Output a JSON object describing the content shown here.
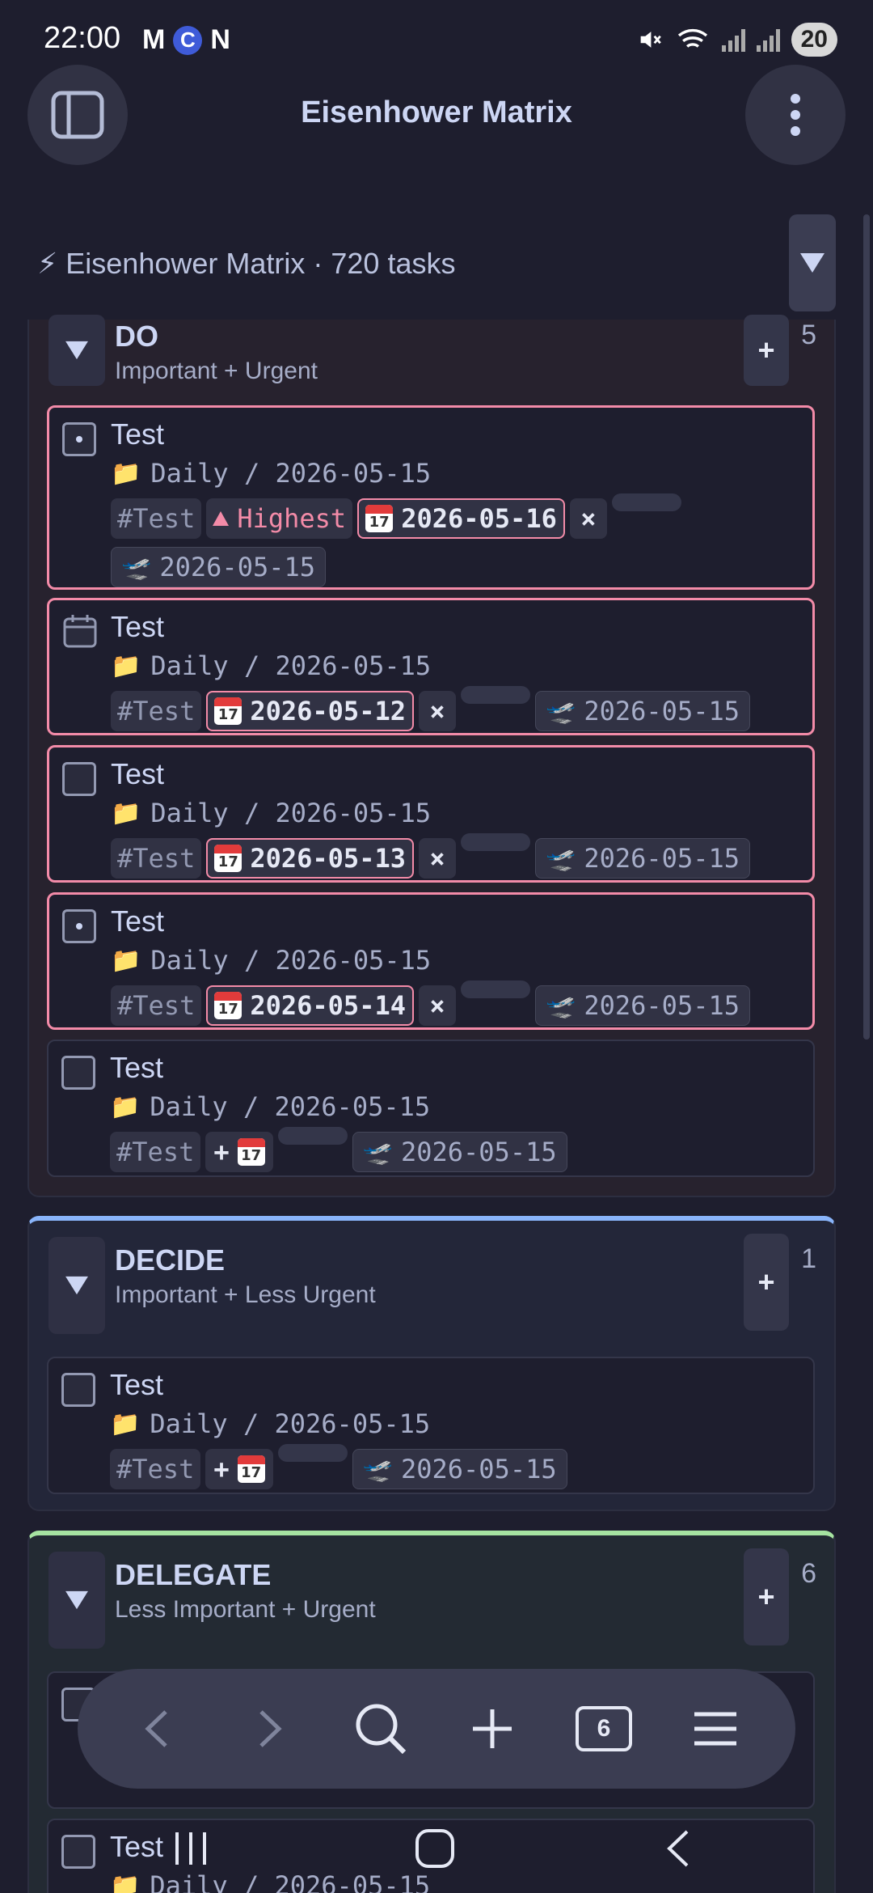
{
  "status": {
    "time": "22:00",
    "battery": "20",
    "apps": [
      "M",
      "C",
      "N"
    ]
  },
  "app": {
    "title": "Eisenhower Matrix"
  },
  "matrix": {
    "title": "⚡ Eisenhower Matrix · 720 tasks"
  },
  "sections": {
    "do": {
      "name": "DO",
      "subtitle": "Important + Urgent",
      "add": "+",
      "count": "5",
      "accent": "#f38ba8"
    },
    "decide": {
      "name": "DECIDE",
      "subtitle": "Important + Less Urgent",
      "add": "+",
      "count": "1",
      "accent": "#89b4fa"
    },
    "delegate": {
      "name": "DELEGATE",
      "subtitle": "Less Important + Urgent",
      "add": "+",
      "count": "6",
      "accent": "#a6e3a1"
    }
  },
  "tasks": {
    "do": [
      {
        "title": "Test",
        "path": "Daily / 2026-05-15",
        "tag": "#Test",
        "priority": "Highest",
        "due": "2026-05-16",
        "created": "2026-05-15",
        "clear": "×"
      },
      {
        "title": "Test",
        "path": "Daily / 2026-05-15",
        "tag": "#Test",
        "due": "2026-05-12",
        "created": "2026-05-15",
        "clear": "×"
      },
      {
        "title": "Test",
        "path": "Daily / 2026-05-15",
        "tag": "#Test",
        "due": "2026-05-13",
        "created": "2026-05-15",
        "clear": "×"
      },
      {
        "title": "Test",
        "path": "Daily / 2026-05-15",
        "tag": "#Test",
        "due": "2026-05-14",
        "created": "2026-05-15",
        "clear": "×"
      },
      {
        "title": "Test",
        "path": "Daily / 2026-05-15",
        "tag": "#Test",
        "add": "+",
        "created": "2026-05-15"
      }
    ],
    "decide": [
      {
        "title": "Test",
        "path": "Daily / 2026-05-15",
        "tag": "#Test",
        "add": "+",
        "created": "2026-05-15"
      }
    ],
    "delegate": [
      {
        "title": "Test",
        "path": "Daily / 2026-05-15"
      }
    ]
  },
  "calendar_emoji_day": "17",
  "browser": {
    "tab_count": "6"
  }
}
